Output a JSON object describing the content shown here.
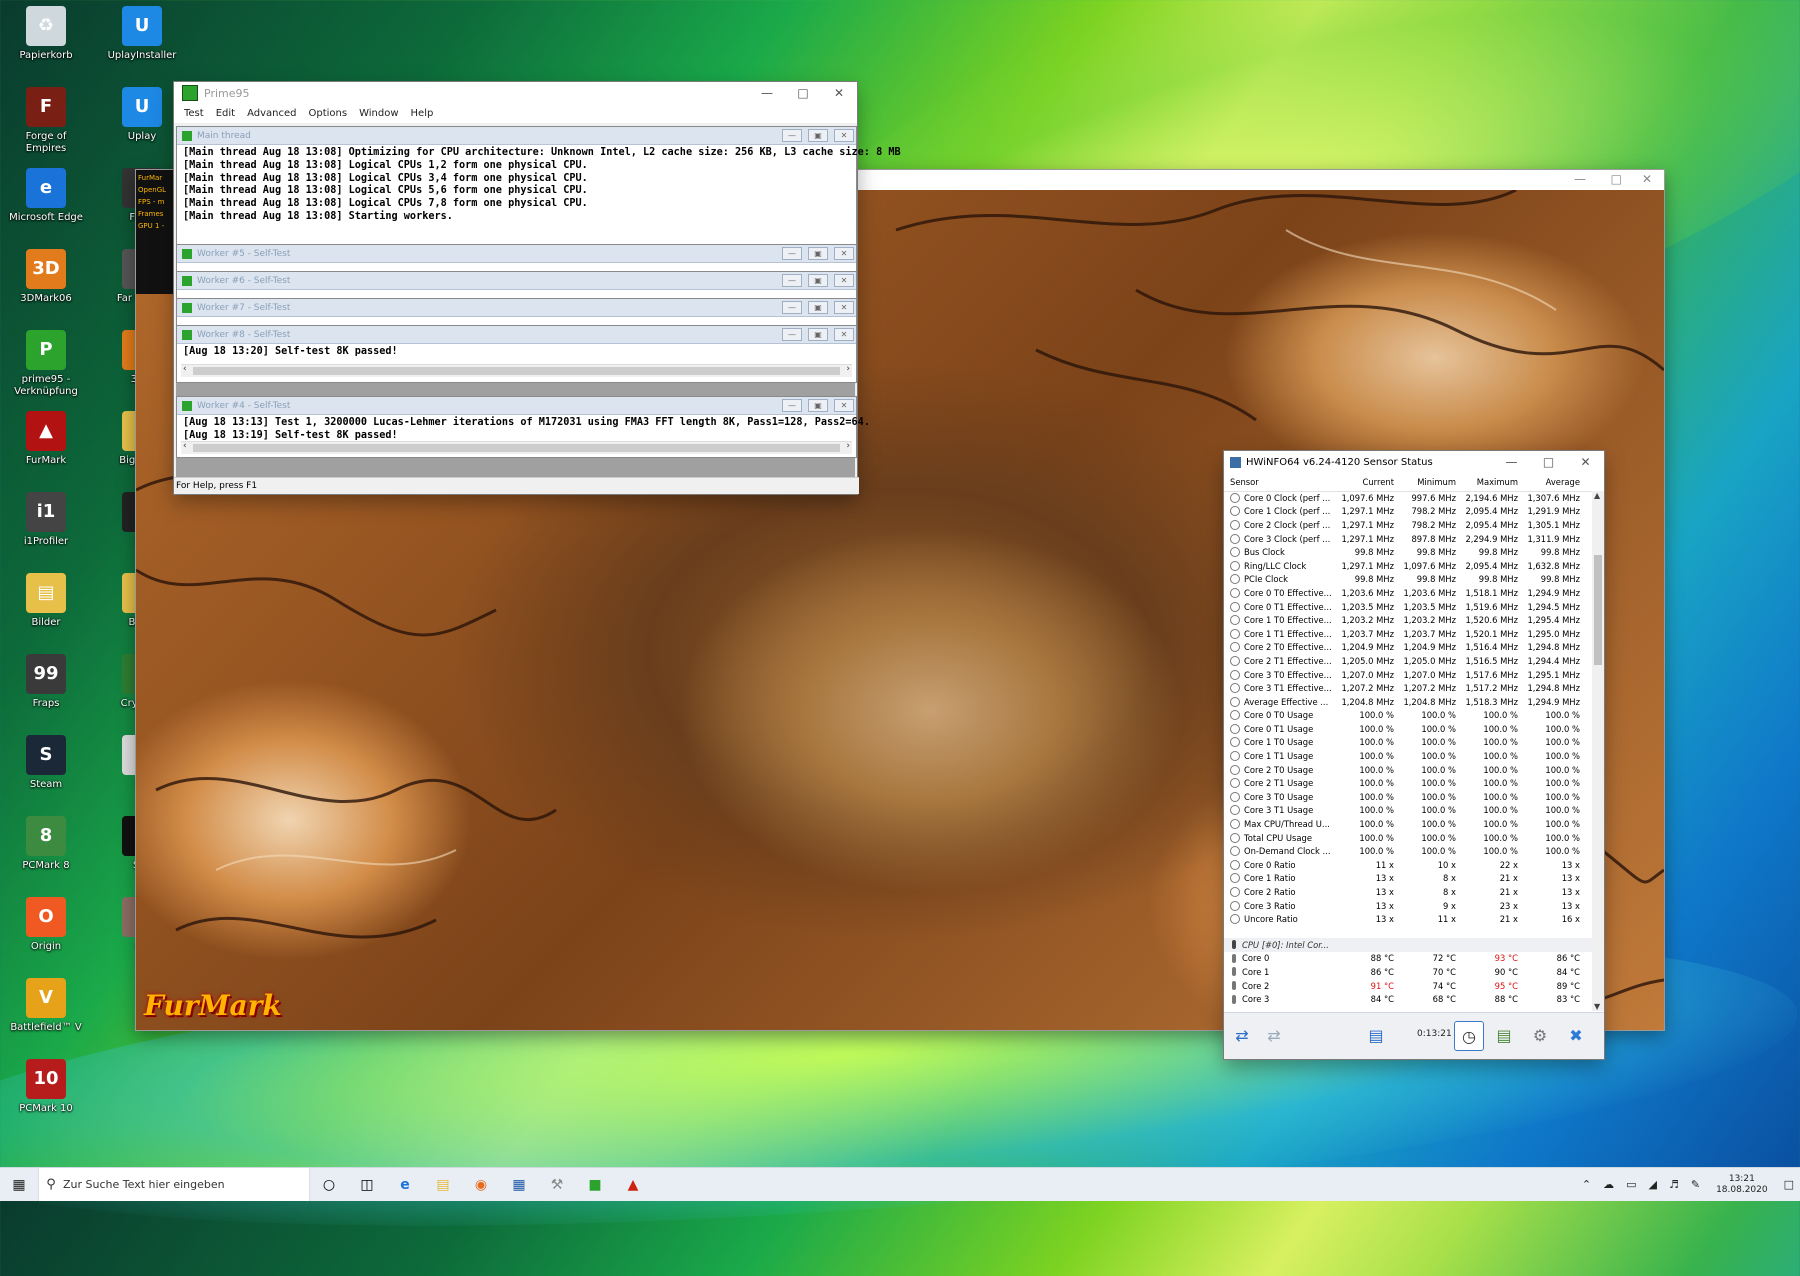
{
  "desktop": {
    "icons_left": [
      {
        "label": "Papierkorb",
        "glyph": "♻",
        "color": "#cfd8dc"
      },
      {
        "label": "Forge of Empires",
        "glyph": "F",
        "color": "#7a1f14"
      },
      {
        "label": "Microsoft Edge",
        "glyph": "e",
        "color": "#1a73d9"
      },
      {
        "label": "3DMark06",
        "glyph": "3D",
        "color": "#e27b1b"
      },
      {
        "label": "prime95 - Verknüpfung",
        "glyph": "P",
        "color": "#2ca32c"
      },
      {
        "label": "FurMark",
        "glyph": "▲",
        "color": "#b31212"
      },
      {
        "label": "i1Profiler",
        "glyph": "i1",
        "color": "#444444"
      },
      {
        "label": "Bilder",
        "glyph": "▤",
        "color": "#e7c04a"
      },
      {
        "label": "Fraps",
        "glyph": "99",
        "color": "#3a3a3a"
      },
      {
        "label": "Steam",
        "glyph": "S",
        "color": "#1b2838"
      },
      {
        "label": "PCMark 8",
        "glyph": "8",
        "color": "#3d8b40"
      },
      {
        "label": "Origin",
        "glyph": "O",
        "color": "#f05a22"
      },
      {
        "label": "Battlefield™ V",
        "glyph": "V",
        "color": "#e6a218"
      },
      {
        "label": "PCMark 10",
        "glyph": "10",
        "color": "#b71c1c"
      }
    ],
    "icons_right": [
      {
        "label": "UplayInstaller",
        "glyph": "U",
        "color": "#1e88e5"
      },
      {
        "label": "Uplay",
        "glyph": "U",
        "color": "#1e88e5"
      },
      {
        "label": "Far C",
        "glyph": "F",
        "color": "#333333"
      },
      {
        "label": "Far Cry Ec",
        "glyph": "F",
        "color": "#555555"
      },
      {
        "label": "3DM",
        "glyph": "3",
        "color": "#e27b1b"
      },
      {
        "label": "Big_Buck",
        "glyph": "▤",
        "color": "#e7c04a"
      },
      {
        "label": "3D",
        "glyph": "3",
        "color": "#222222"
      },
      {
        "label": "Batte",
        "glyph": "▤",
        "color": "#e7c04a"
      },
      {
        "label": "CrystalD",
        "glyph": "C",
        "color": "#2e7d32"
      },
      {
        "label": "Ba",
        "glyph": "▤",
        "color": "#dddddd"
      },
      {
        "label": "Sch",
        "glyph": "■",
        "color": "#111111"
      },
      {
        "label": "ref",
        "glyph": "▤",
        "color": "#8d6e63"
      }
    ]
  },
  "furmark": {
    "logo": "FurMark",
    "overlay_lines": [
      "FurMar",
      "OpenGL",
      "FPS - m",
      "Frames",
      "GPU 1 -"
    ]
  },
  "prime95": {
    "title": "Prime95",
    "menu": [
      "Test",
      "Edit",
      "Advanced",
      "Options",
      "Window",
      "Help"
    ],
    "main_title": "Main thread",
    "main_log": [
      "[Main thread Aug 18 13:08] Optimizing for CPU architecture: Unknown Intel, L2 cache size: 256 KB, L3 cache size: 8 MB",
      "[Main thread Aug 18 13:08] Logical CPUs 1,2 form one physical CPU.",
      "[Main thread Aug 18 13:08] Logical CPUs 3,4 form one physical CPU.",
      "[Main thread Aug 18 13:08] Logical CPUs 5,6 form one physical CPU.",
      "[Main thread Aug 18 13:08] Logical CPUs 7,8 form one physical CPU.",
      "[Main thread Aug 18 13:08] Starting workers."
    ],
    "workers": [
      {
        "title": "Worker #5 - Self-Test"
      },
      {
        "title": "Worker #6 - Self-Test"
      },
      {
        "title": "Worker #7 - Self-Test"
      },
      {
        "title": "Worker #8 - Self-Test",
        "log": [
          "[Aug 18 13:20] Self-test 8K passed!"
        ]
      }
    ],
    "worker4": {
      "title": "Worker #4 - Self-Test",
      "log": [
        "[Aug 18 13:13] Test 1, 3200000 Lucas-Lehmer iterations of M172031 using FMA3 FFT length 8K, Pass1=128, Pass2=64.",
        "[Aug 18 13:19] Self-test 8K passed!"
      ]
    },
    "status": "For Help, press F1"
  },
  "hwinfo": {
    "title": "HWiNFO64 v6.24-4120 Sensor Status",
    "columns": [
      "Sensor",
      "Current",
      "Minimum",
      "Maximum",
      "Average"
    ],
    "rows": [
      [
        "Core 0 Clock (perf ...",
        "1,097.6 MHz",
        "997.6 MHz",
        "2,194.6 MHz",
        "1,307.6 MHz"
      ],
      [
        "Core 1 Clock (perf ...",
        "1,297.1 MHz",
        "798.2 MHz",
        "2,095.4 MHz",
        "1,291.9 MHz"
      ],
      [
        "Core 2 Clock (perf ...",
        "1,297.1 MHz",
        "798.2 MHz",
        "2,095.4 MHz",
        "1,305.1 MHz"
      ],
      [
        "Core 3 Clock (perf ...",
        "1,297.1 MHz",
        "897.8 MHz",
        "2,294.9 MHz",
        "1,311.9 MHz"
      ],
      [
        "Bus Clock",
        "99.8 MHz",
        "99.8 MHz",
        "99.8 MHz",
        "99.8 MHz"
      ],
      [
        "Ring/LLC Clock",
        "1,297.1 MHz",
        "1,097.6 MHz",
        "2,095.4 MHz",
        "1,632.8 MHz"
      ],
      [
        "PCIe Clock",
        "99.8 MHz",
        "99.8 MHz",
        "99.8 MHz",
        "99.8 MHz"
      ],
      [
        "Core 0 T0 Effective...",
        "1,203.6 MHz",
        "1,203.6 MHz",
        "1,518.1 MHz",
        "1,294.9 MHz"
      ],
      [
        "Core 0 T1 Effective...",
        "1,203.5 MHz",
        "1,203.5 MHz",
        "1,519.6 MHz",
        "1,294.5 MHz"
      ],
      [
        "Core 1 T0 Effective...",
        "1,203.2 MHz",
        "1,203.2 MHz",
        "1,520.6 MHz",
        "1,295.4 MHz"
      ],
      [
        "Core 1 T1 Effective...",
        "1,203.7 MHz",
        "1,203.7 MHz",
        "1,520.1 MHz",
        "1,295.0 MHz"
      ],
      [
        "Core 2 T0 Effective...",
        "1,204.9 MHz",
        "1,204.9 MHz",
        "1,516.4 MHz",
        "1,294.8 MHz"
      ],
      [
        "Core 2 T1 Effective...",
        "1,205.0 MHz",
        "1,205.0 MHz",
        "1,516.5 MHz",
        "1,294.4 MHz"
      ],
      [
        "Core 3 T0 Effective...",
        "1,207.0 MHz",
        "1,207.0 MHz",
        "1,517.6 MHz",
        "1,295.1 MHz"
      ],
      [
        "Core 3 T1 Effective...",
        "1,207.2 MHz",
        "1,207.2 MHz",
        "1,517.2 MHz",
        "1,294.8 MHz"
      ],
      [
        "Average Effective ...",
        "1,204.8 MHz",
        "1,204.8 MHz",
        "1,518.3 MHz",
        "1,294.9 MHz"
      ],
      [
        "Core 0 T0 Usage",
        "100.0 %",
        "100.0 %",
        "100.0 %",
        "100.0 %"
      ],
      [
        "Core 0 T1 Usage",
        "100.0 %",
        "100.0 %",
        "100.0 %",
        "100.0 %"
      ],
      [
        "Core 1 T0 Usage",
        "100.0 %",
        "100.0 %",
        "100.0 %",
        "100.0 %"
      ],
      [
        "Core 1 T1 Usage",
        "100.0 %",
        "100.0 %",
        "100.0 %",
        "100.0 %"
      ],
      [
        "Core 2 T0 Usage",
        "100.0 %",
        "100.0 %",
        "100.0 %",
        "100.0 %"
      ],
      [
        "Core 2 T1 Usage",
        "100.0 %",
        "100.0 %",
        "100.0 %",
        "100.0 %"
      ],
      [
        "Core 3 T0 Usage",
        "100.0 %",
        "100.0 %",
        "100.0 %",
        "100.0 %"
      ],
      [
        "Core 3 T1 Usage",
        "100.0 %",
        "100.0 %",
        "100.0 %",
        "100.0 %"
      ],
      [
        "Max CPU/Thread U...",
        "100.0 %",
        "100.0 %",
        "100.0 %",
        "100.0 %"
      ],
      [
        "Total CPU Usage",
        "100.0 %",
        "100.0 %",
        "100.0 %",
        "100.0 %"
      ],
      [
        "On-Demand Clock ...",
        "100.0 %",
        "100.0 %",
        "100.0 %",
        "100.0 %"
      ],
      [
        "Core 0 Ratio",
        "11 x",
        "10 x",
        "22 x",
        "13 x"
      ],
      [
        "Core 1 Ratio",
        "13 x",
        "8 x",
        "21 x",
        "13 x"
      ],
      [
        "Core 2 Ratio",
        "13 x",
        "8 x",
        "21 x",
        "13 x"
      ],
      [
        "Core 3 Ratio",
        "13 x",
        "9 x",
        "23 x",
        "13 x"
      ],
      [
        "Uncore Ratio",
        "13 x",
        "11 x",
        "21 x",
        "16 x"
      ]
    ],
    "group": "CPU [#0]: Intel Cor...",
    "temps": [
      {
        "cells": [
          "Core 0",
          "88 °C",
          "72 °C",
          "93 °C",
          "86 °C"
        ],
        "red": [
          3
        ]
      },
      {
        "cells": [
          "Core 1",
          "86 °C",
          "70 °C",
          "90 °C",
          "84 °C"
        ],
        "red": []
      },
      {
        "cells": [
          "Core 2",
          "91 °C",
          "74 °C",
          "95 °C",
          "89 °C"
        ],
        "red": [
          1,
          3
        ]
      },
      {
        "cells": [
          "Core 3",
          "84 °C",
          "68 °C",
          "88 °C",
          "83 °C"
        ],
        "red": []
      }
    ],
    "timer": "0:13:21"
  },
  "taskbar": {
    "search_placeholder": "Zur Suche Text hier eingeben",
    "time": "13:21",
    "date": "18.08.2020"
  }
}
